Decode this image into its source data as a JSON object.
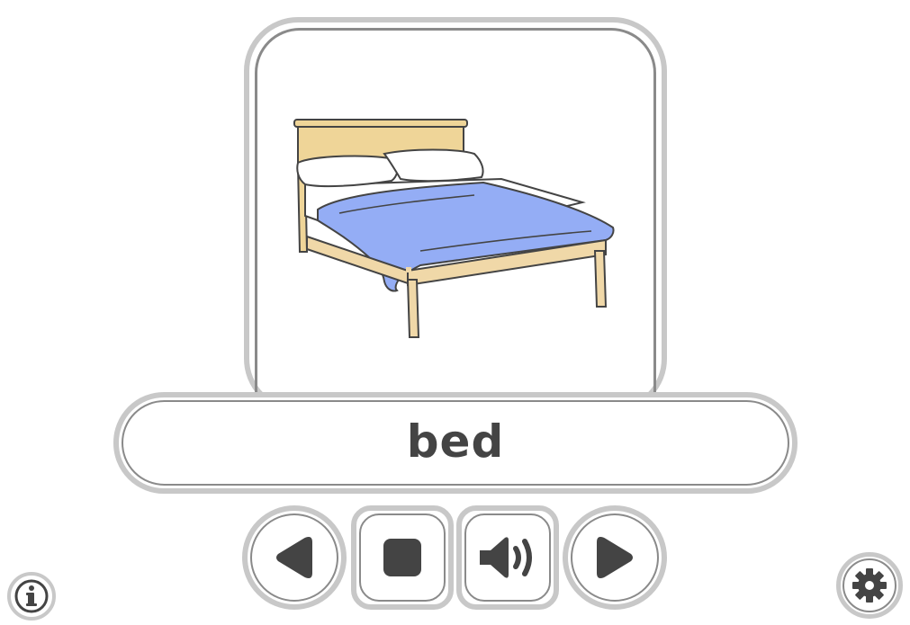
{
  "card": {
    "word": "bed",
    "image_icon": "bed-illustration"
  },
  "controls": {
    "previous_icon": "triangle-left-icon",
    "stop_icon": "stop-square-icon",
    "sound_icon": "speaker-icon",
    "next_icon": "triangle-right-icon"
  },
  "corner": {
    "info_icon": "info-icon",
    "settings_icon": "gear-icon"
  },
  "colors": {
    "button_border": "#c8c8c8",
    "icon": "#444444",
    "blanket": "#94adf5",
    "wood": "#f0d8a8",
    "headboard": "#efd598"
  }
}
